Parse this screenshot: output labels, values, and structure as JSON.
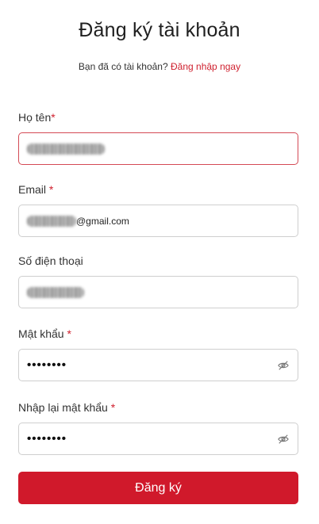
{
  "header": {
    "title": "Đăng ký tài khoản",
    "have_account_text": "Bạn đã có tài khoản?",
    "login_link": "Đăng nhập ngay"
  },
  "form": {
    "fullname": {
      "label": "Họ tên",
      "required_mark": "*",
      "value_obscured": true
    },
    "email": {
      "label": "Email",
      "required_mark": "*",
      "value_suffix": "@gmail.com"
    },
    "phone": {
      "label": "Số điện thoại",
      "value_obscured": true
    },
    "password": {
      "label": "Mật khẩu",
      "required_mark": "*",
      "masked_value": "••••••••",
      "toggle_icon": "eye-off-icon"
    },
    "confirm_password": {
      "label": "Nhập lại mật khẩu",
      "required_mark": "*",
      "masked_value": "••••••••",
      "toggle_icon": "eye-off-icon"
    },
    "submit_label": "Đăng ký"
  },
  "colors": {
    "accent": "#d0192b",
    "error_border": "#d44a55",
    "field_border": "#cfcfcf"
  }
}
